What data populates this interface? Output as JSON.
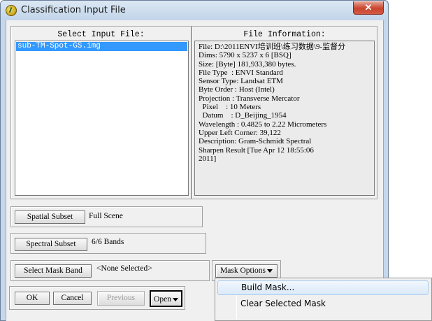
{
  "window": {
    "title": "Classification Input File",
    "close_glyph": "✕",
    "icon": "envi-globe-icon"
  },
  "input_panel": {
    "header": "Select Input File:",
    "files": [
      "sub-TM-Spot-GS.img"
    ]
  },
  "info_panel": {
    "header": "File Information:",
    "lines": [
      "File: D:\\2011ENVI培训班\\练习数据\\9-监督分",
      "Dims: 5790 x 5237 x 6 [BSQ]",
      "Size: [Byte] 181,933,380 bytes.",
      "File Type  : ENVI Standard",
      "Sensor Type: Landsat ETM",
      "Byte Order : Host (Intel)",
      "Projection : Transverse Mercator",
      "  Pixel    : 10 Meters",
      "  Datum    : D_Beijing_1954",
      "Wavelength : 0.4825 to 2.22 Micrometers",
      "Upper Left Corner: 39,122",
      "Description: Gram-Schmidt Spectral",
      "Sharpen Result [Tue Apr 12 18:55:06",
      "2011]"
    ]
  },
  "spatial_subset": {
    "button": "Spatial Subset",
    "value": "Full Scene"
  },
  "spectral_subset": {
    "button": "Spectral Subset",
    "value": "6/6 Bands"
  },
  "mask_band": {
    "button": "Select Mask Band",
    "value": "<None Selected>",
    "options_button": "Mask Options"
  },
  "footer": {
    "ok": "OK",
    "cancel": "Cancel",
    "previous": "Previous",
    "open": "Open"
  },
  "mask_menu": {
    "items": [
      "Build Mask...",
      "Clear Selected Mask"
    ],
    "highlighted_index": 0
  }
}
